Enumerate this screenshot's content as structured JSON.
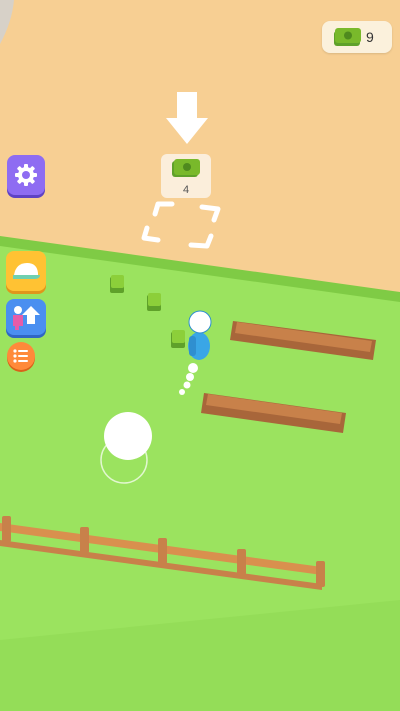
{
  "hud": {
    "money_value": "9",
    "money_icon": "cash-icon"
  },
  "build_spot": {
    "cost": "4",
    "icon": "cash-icon",
    "hint_icon": "down-arrow-icon"
  },
  "side_menu": {
    "icons": [
      "gear-icon",
      "cap-icon",
      "upgrade-arrow-icon",
      "list-icon"
    ]
  },
  "colors": {
    "sand": "#f7cf93",
    "grass": "#9be35f",
    "grass_edge": "#7fcb45",
    "fence": "#c8814a",
    "cash": "#79b92b",
    "player": "#3aa6e6"
  }
}
